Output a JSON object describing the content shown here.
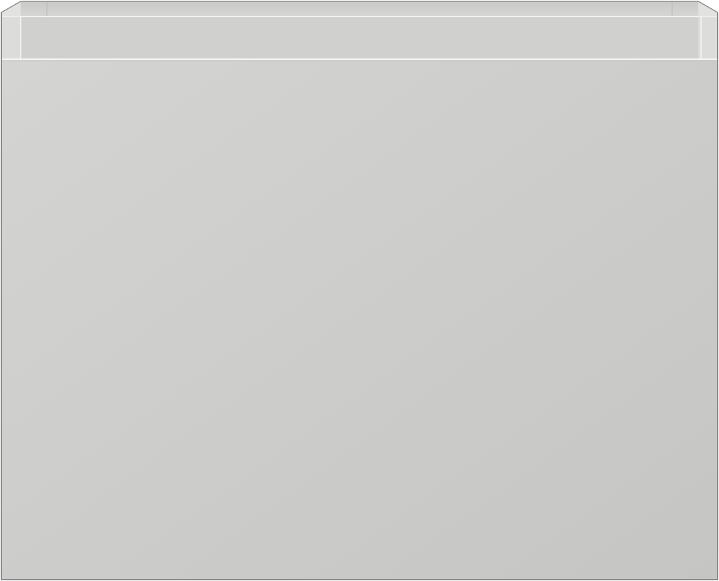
{
  "image": {
    "subject": "cabinet",
    "colors": {
      "background": "#ffffff",
      "front_panel_light": "#d3d3d1",
      "front_panel_dark": "#c6c6c4",
      "top_rail": "#d0d0ce",
      "inner_back_wall": "#cfcfcd",
      "side_wall": "#e0e0de",
      "edge_highlight": "#f2f2f0",
      "outline": "#8a8a88"
    }
  }
}
